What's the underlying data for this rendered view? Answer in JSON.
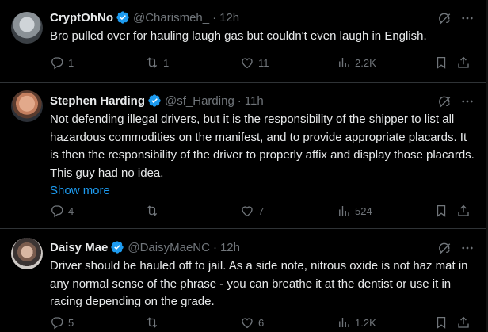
{
  "tweets": [
    {
      "name": "CryptOhNo",
      "handle": "@Charismeh_",
      "separator": "·",
      "time": "12h",
      "text": "Bro pulled over for hauling laugh gas but couldn't even laugh in English.",
      "show_more": "",
      "replies": "1",
      "retweets": "1",
      "likes": "11",
      "views": "2.2K"
    },
    {
      "name": "Stephen Harding",
      "handle": "@sf_Harding",
      "separator": "·",
      "time": "11h",
      "text": "Not defending illegal drivers, but it is the responsibility of the shipper to list all hazardous commodities on the manifest, and to provide appropriate placards. It is then the responsibility of the driver to properly affix and display those placards. This guy had no idea.",
      "show_more": "Show more",
      "replies": "4",
      "retweets": "",
      "likes": "7",
      "views": "524"
    },
    {
      "name": "Daisy Mae",
      "handle": "@DaisyMaeNC",
      "separator": "·",
      "time": "12h",
      "text": "Driver should be hauled off to jail. As a side note, nitrous oxide is not haz mat in any normal sense of the phrase - you can breathe it at the dentist or use it in racing depending on the grade.",
      "show_more": "",
      "replies": "5",
      "retweets": "",
      "likes": "6",
      "views": "1.2K"
    }
  ],
  "colors": {
    "background": "#000000",
    "text": "#e7e9ea",
    "muted": "#71767b",
    "link": "#1d9bf0",
    "divider": "#2f3336",
    "verified": "#1d9bf0"
  }
}
